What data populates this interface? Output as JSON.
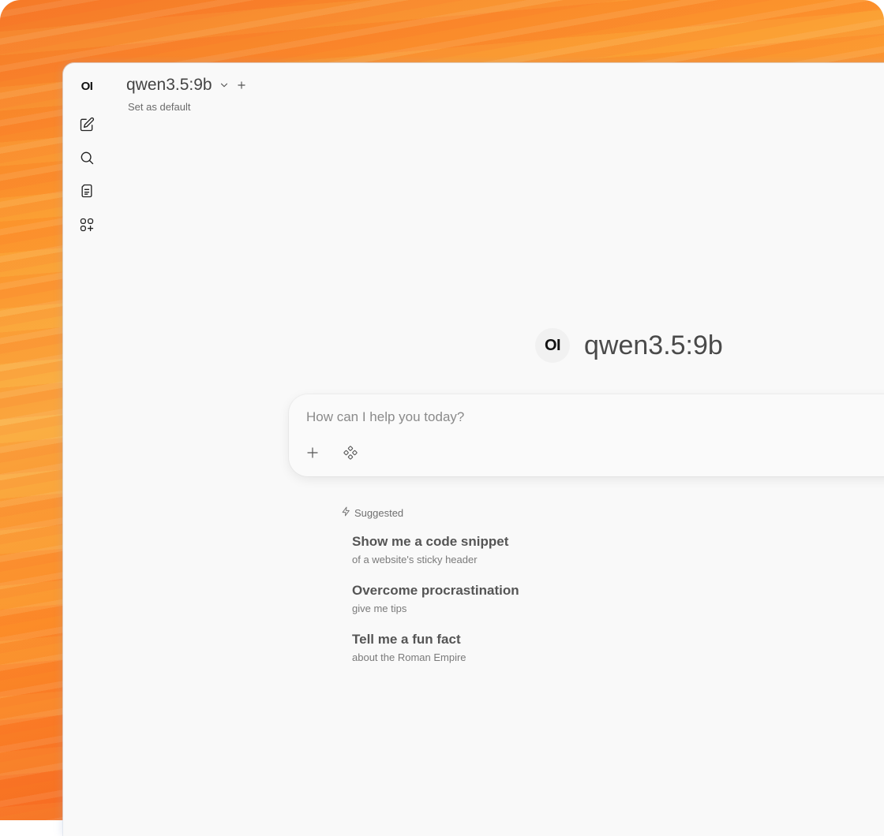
{
  "sidebar": {
    "logo": "OI",
    "items": [
      {
        "icon": "new-chat-icon"
      },
      {
        "icon": "search-icon"
      },
      {
        "icon": "notes-icon"
      },
      {
        "icon": "workspace-icon"
      }
    ]
  },
  "header": {
    "model_name": "qwen3.5:9b",
    "set_default_label": "Set as default"
  },
  "hero": {
    "logo": "OI",
    "model_name": "qwen3.5:9b"
  },
  "composer": {
    "placeholder": "How can I help you today?"
  },
  "suggested": {
    "heading": "Suggested",
    "items": [
      {
        "title": "Show me a code snippet",
        "subtitle": "of a website's sticky header"
      },
      {
        "title": "Overcome procrastination",
        "subtitle": "give me tips"
      },
      {
        "title": "Tell me a fun fact",
        "subtitle": "about the Roman Empire"
      }
    ]
  },
  "colors": {
    "background_accent": "#f98f2c",
    "window_bg": "#f9f9f9"
  }
}
